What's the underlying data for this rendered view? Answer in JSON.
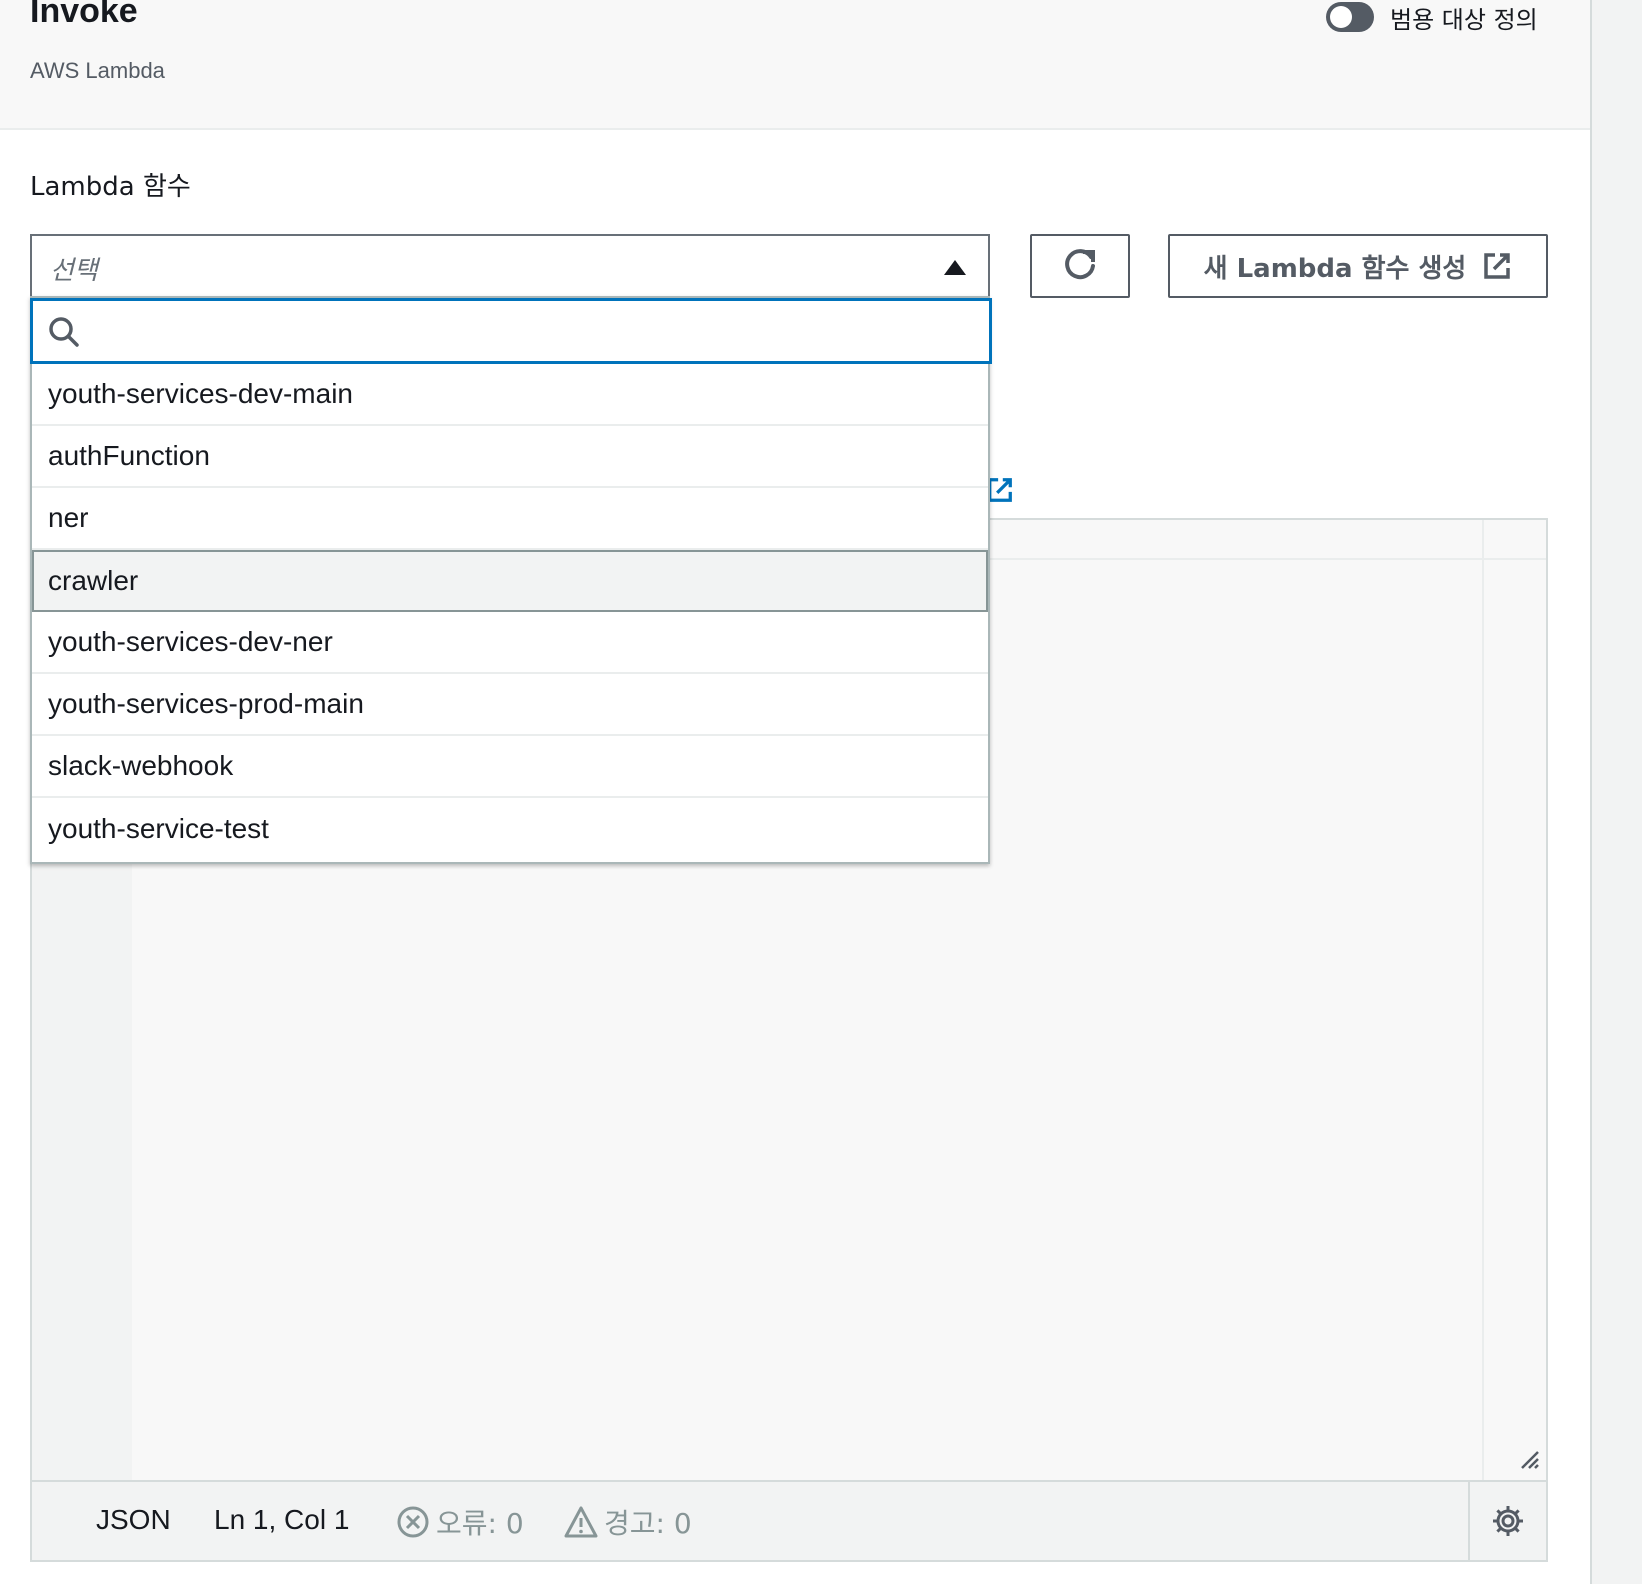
{
  "header": {
    "title": "Invoke",
    "subtitle": "AWS Lambda",
    "toggle_label": "범용 대상 정의"
  },
  "form": {
    "field_label": "Lambda 함수",
    "select_placeholder": "선택",
    "create_button_label": "새 Lambda 함수 생성"
  },
  "dropdown": {
    "search_value": "",
    "highlighted_index": 3,
    "options": [
      {
        "label": "youth-services-dev-main"
      },
      {
        "label": "authFunction"
      },
      {
        "label": "ner"
      },
      {
        "label": "crawler"
      },
      {
        "label": "youth-services-dev-ner"
      },
      {
        "label": "youth-services-prod-main"
      },
      {
        "label": "slack-webhook"
      },
      {
        "label": "youth-service-test"
      }
    ]
  },
  "editor": {
    "language": "JSON",
    "cursor_position": "Ln 1, Col 1",
    "errors_label": "오류: 0",
    "warnings_label": "경고: 0"
  },
  "colors": {
    "focus_blue": "#0073bb",
    "link_blue": "#0073bb",
    "text_dark": "#16191f",
    "muted_gray": "#879596"
  },
  "icons": {
    "toggle": "toggle-off-icon",
    "caret": "caret-up-icon",
    "refresh": "refresh-icon",
    "external": "external-link-icon",
    "search": "search-icon",
    "error": "error-circle-icon",
    "warning": "warning-triangle-icon",
    "settings": "gear-icon",
    "resize": "resize-handle-icon"
  }
}
